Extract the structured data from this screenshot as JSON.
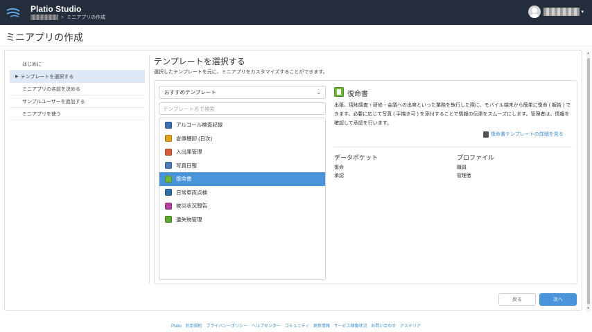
{
  "header": {
    "app_title": "Platio Studio",
    "breadcrumb_sep": ">",
    "breadcrumb_current": "ミニアプリの作成"
  },
  "page_title": "ミニアプリの作成",
  "steps": [
    {
      "label": "はじめに"
    },
    {
      "label": "テンプレートを選択する"
    },
    {
      "label": "ミニアプリの名前を決める"
    },
    {
      "label": "サンプルユーザーを追加する"
    },
    {
      "label": "ミニアプリを使う"
    }
  ],
  "section": {
    "title": "テンプレートを選択する",
    "description": "選択したテンプレートを元に、ミニアプリをカスタマイズすることができます。"
  },
  "template_select": {
    "value": "おすすめテンプレート"
  },
  "search": {
    "placeholder": "テンプレート名で検索"
  },
  "templates": [
    {
      "label": "アルコール検査記録",
      "icon": "breathalyzer-icon",
      "color": "#3b6fb6"
    },
    {
      "label": "倉庫棚卸 (日次)",
      "icon": "warehouse-icon",
      "color": "#e2a31e"
    },
    {
      "label": "入出庫管理",
      "icon": "inventory-icon",
      "color": "#d95c3d"
    },
    {
      "label": "写真日報",
      "icon": "photo-icon",
      "color": "#4c7fb8"
    },
    {
      "label": "復命書",
      "icon": "report-icon",
      "color": "#6fba3a"
    },
    {
      "label": "日常車両点検",
      "icon": "car-icon",
      "color": "#2f6fa8"
    },
    {
      "label": "被災状況報告",
      "icon": "disaster-icon",
      "color": "#b044a0"
    },
    {
      "label": "遺失物管理",
      "icon": "lost-item-icon",
      "color": "#5aa832"
    }
  ],
  "selected_index": 4,
  "detail": {
    "title": "復命書",
    "description": "出張、現地調査・研修・会議への出席といった業務を執行した際に、モバイル端末から簡単に復命 ( 報告 ) できます。必要に応じて写真 ( 手描き可 ) を添付することで情報の伝達をスムーズにします。管理者は、情報を確認して承認を行います。",
    "link": "復命書テンプレートの詳細を見る",
    "data_pocket_head": "データポケット",
    "data_pockets": [
      "復命",
      "承認"
    ],
    "profile_head": "プロファイル",
    "profiles": [
      "職員",
      "管理者"
    ]
  },
  "buttons": {
    "back": "戻る",
    "next": "次へ"
  },
  "footer": [
    "Platio",
    "利用規約",
    "プライバシーポリシー",
    "ヘルプセンター",
    "コミュニティ",
    "更新情報",
    "サービス稼働状況",
    "お問い合わせ",
    "アステリア"
  ],
  "colors": {
    "header_bg": "#232d3b",
    "accent": "#4a95d9",
    "link": "#3a8fd6"
  }
}
